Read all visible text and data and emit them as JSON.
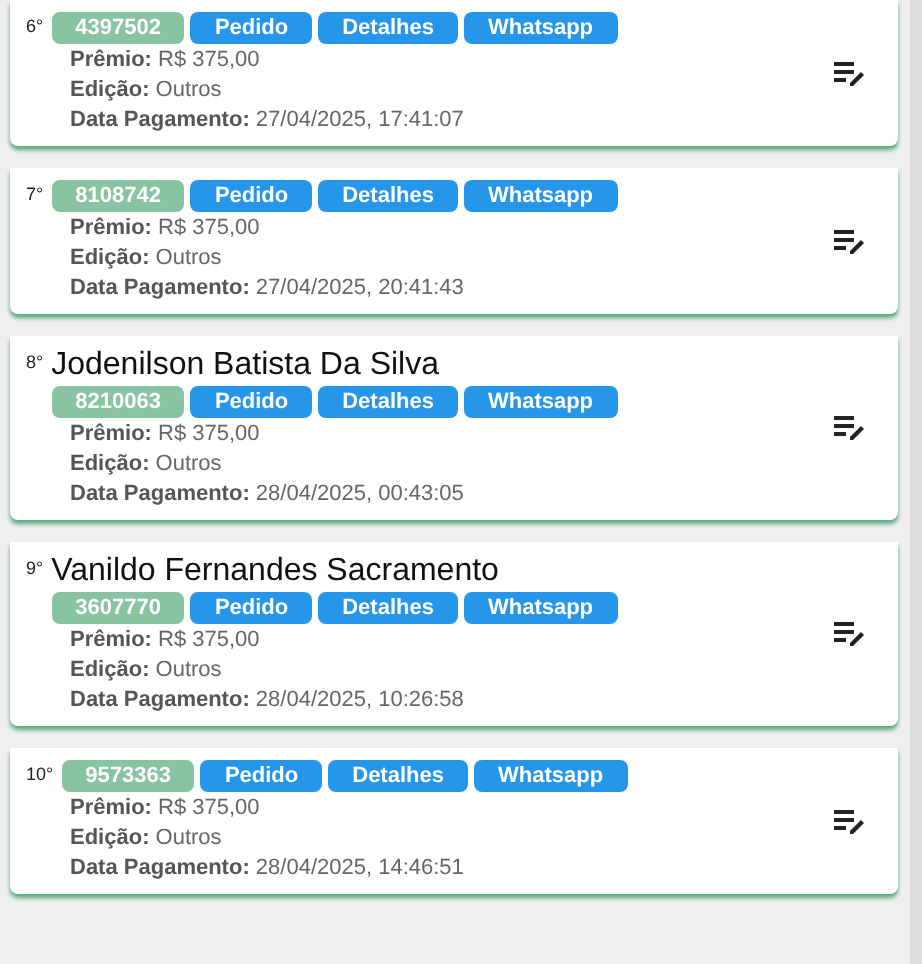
{
  "entries": [
    {
      "rank": "6°",
      "code": "4397502",
      "buttons": [
        "Pedido",
        "Detalhes",
        "Whatsapp"
      ],
      "details": [
        "**Prêmio:** R$ 375,00",
        "**Edição:** Outros",
        "**Data Pagamento:** 27/04/2025, 17:41:07"
      ]
    },
    {
      "rank": "7°",
      "code": "8108742",
      "buttons": [
        "Pedido",
        "Detalhes",
        "Whatsapp"
      ],
      "details": [
        "**Prêmio:** R$ 375,00",
        "**Edição:** Outros",
        "**Data Pagamento:** 27/04/2025, 20:41:43"
      ]
    },
    {
      "rank": "8°",
      "name": "Jodenilson Batista Da Silva",
      "code": "8210063",
      "buttons": [
        "Pedido",
        "Detalhes",
        "Whatsapp"
      ],
      "details": [
        "**Prêmio:** R$ 375,00",
        "**Edição:** Outros",
        "**Data Pagamento:** 28/04/2025, 00:43:05"
      ]
    },
    {
      "rank": "9°",
      "name": "Vanildo Fernandes Sacramento",
      "code": "3607770",
      "buttons": [
        "Pedido",
        "Detalhes",
        "Whatsapp"
      ],
      "details": [
        "**Prêmio:** R$ 375,00",
        "**Edição:** Outros",
        "**Data Pagamento:** 28/04/2025, 10:26:58"
      ]
    },
    {
      "rank": "10°",
      "code": "9573363",
      "buttons": [
        "Pedido",
        "Detalhes",
        "Whatsapp"
      ],
      "details": [
        "**Prêmio:** R$ 375,00",
        "**Edição:** Outros",
        "**Data Pagamento:** 28/04/2025, 14:46:51"
      ]
    }
  ]
}
